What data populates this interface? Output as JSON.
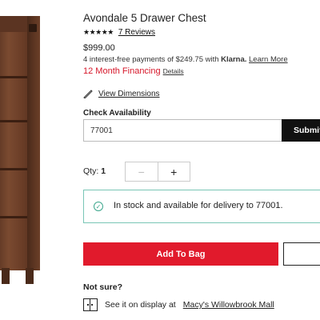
{
  "product": {
    "title": "Avondale 5 Drawer Chest",
    "stars": "★★★★★",
    "reviews_label": "7 Reviews",
    "price": "$999.00",
    "klarna_prefix": "4 interest-free payments of $249.75 with ",
    "klarna_brand": "Klarna.",
    "klarna_link": "Learn More",
    "financing": "12 Month Financing",
    "financing_details": "Details",
    "dimensions_link": "View Dimensions"
  },
  "availability": {
    "label": "Check Availability",
    "zip_value": "77001",
    "submit_label": "Submit"
  },
  "quantity": {
    "label": "Qty:",
    "value": "1",
    "minus": "−",
    "plus": "+"
  },
  "stock": {
    "message": "In stock and available for delivery to 77001."
  },
  "actions": {
    "add_to_bag": "Add To Bag"
  },
  "display": {
    "not_sure": "Not sure?",
    "see_it": "See it on display at",
    "store": "Macy's Willowbrook Mall"
  },
  "colors": {
    "accent_red": "#e11a2c",
    "stock_border": "#79c6b6",
    "submit_bg": "#111111"
  }
}
